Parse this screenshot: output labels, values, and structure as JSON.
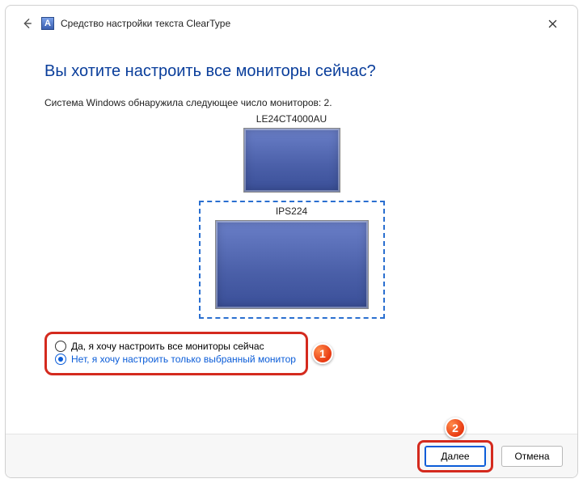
{
  "titlebar": {
    "app_title": "Средство настройки текста ClearType",
    "app_icon_letter": "A"
  },
  "page": {
    "heading": "Вы хотите настроить все мониторы сейчас?",
    "subtext": "Система Windows обнаружила следующее число мониторов: 2."
  },
  "monitors": {
    "top_label": "LE24CT4000AU",
    "selected_label": "IPS224"
  },
  "options": {
    "opt_all": "Да, я хочу настроить все мониторы сейчас",
    "opt_selected": "Нет, я хочу настроить только выбранный монитор"
  },
  "markers": {
    "one": "1",
    "two": "2"
  },
  "footer": {
    "next": "Далее",
    "cancel": "Отмена"
  }
}
